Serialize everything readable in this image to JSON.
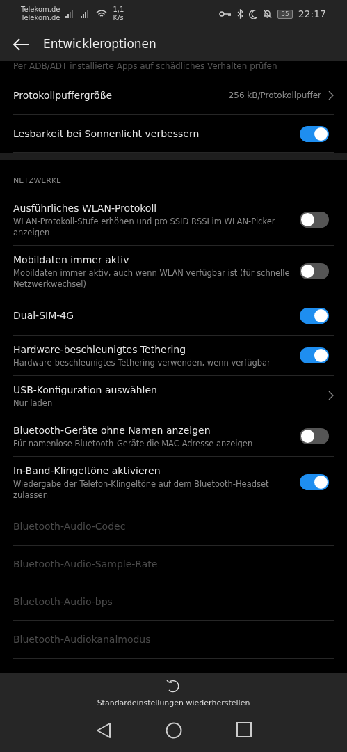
{
  "status_bar": {
    "carriers": [
      "Telekom.de",
      "Telekom.de"
    ],
    "speed": [
      "1,1",
      "K/s"
    ],
    "battery": "55",
    "time": "22:17"
  },
  "header": {
    "title": "Entwickleroptionen"
  },
  "partial_row": {
    "subtitle": "Per ADB/ADT installierte Apps auf schädliches Verhalten prüfen"
  },
  "sections": [
    {
      "items": [
        {
          "kind": "chevron",
          "title": "Protokollpuffergröße",
          "value": "256 kB/Protokollpuffer",
          "disabled": false
        },
        {
          "kind": "toggle",
          "title": "Lesbarkeit bei Sonnenlicht verbessern",
          "on": true,
          "disabled": false
        }
      ]
    },
    {
      "heading": "NETZWERKE",
      "items": [
        {
          "kind": "toggle",
          "title": "Ausführliches WLAN-Protokoll",
          "subtitle": "WLAN-Protokoll-Stufe erhöhen und pro SSID RSSI im WLAN-Picker anzeigen",
          "on": false,
          "disabled": false
        },
        {
          "kind": "toggle",
          "title": "Mobildaten immer aktiv",
          "subtitle": "Mobildaten immer aktiv, auch wenn WLAN verfügbar ist (für schnelle Netzwerkwechsel)",
          "on": false,
          "disabled": false
        },
        {
          "kind": "toggle",
          "title": "Dual-SIM-4G",
          "on": true,
          "disabled": false
        },
        {
          "kind": "toggle",
          "title": "Hardware-beschleunigtes Tethering",
          "subtitle": "Hardware-beschleunigtes Tethering verwenden, wenn verfügbar",
          "on": true,
          "disabled": false
        },
        {
          "kind": "chevron",
          "title": "USB-Konfiguration auswählen",
          "subtitle": "Nur laden",
          "disabled": false
        },
        {
          "kind": "toggle",
          "title": "Bluetooth-Geräte ohne Namen anzeigen",
          "subtitle": "Für namenlose Bluetooth-Geräte die MAC-Adresse anzeigen",
          "on": false,
          "disabled": false
        },
        {
          "kind": "toggle",
          "title": "In-Band-Klingeltöne aktivieren",
          "subtitle": "Wiedergabe der Telefon-Klingeltöne auf dem Bluetooth-Headset zulassen",
          "on": true,
          "disabled": false
        },
        {
          "kind": "plain",
          "title": "Bluetooth-Audio-Codec",
          "disabled": true
        },
        {
          "kind": "plain",
          "title": "Bluetooth-Audio-Sample-Rate",
          "disabled": true
        },
        {
          "kind": "plain",
          "title": "Bluetooth-Audio-bps",
          "disabled": true
        },
        {
          "kind": "plain",
          "title": "Bluetooth-Audiokanalmodus",
          "disabled": true
        }
      ]
    }
  ],
  "bottom_action": {
    "label": "Standardeinstellungen wiederherstellen"
  }
}
